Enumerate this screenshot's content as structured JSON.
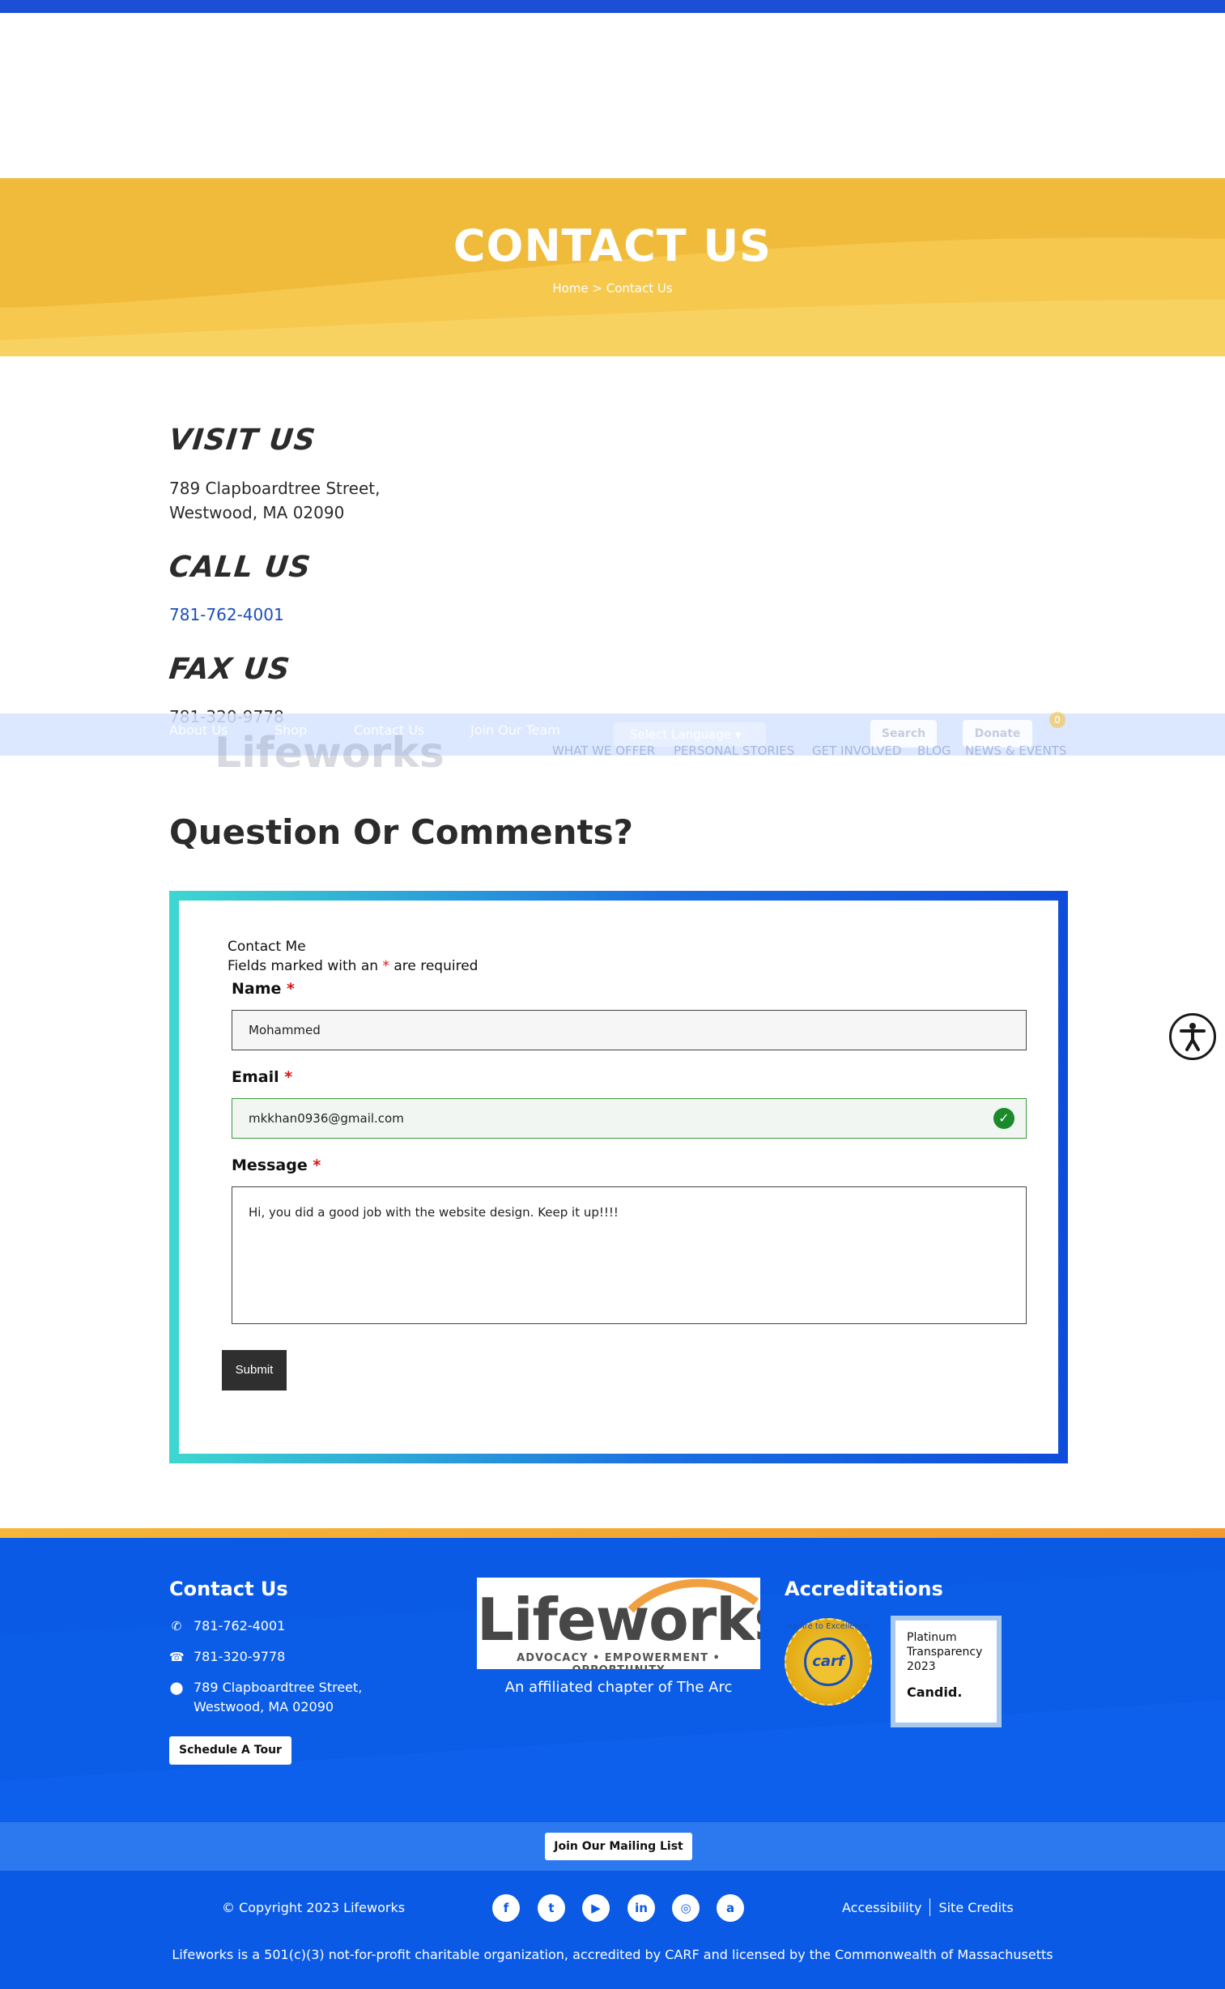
{
  "hero": {
    "title": "CONTACT US",
    "breadcrumb": "Home > Contact Us"
  },
  "visit": {
    "heading": "VISIT US",
    "address_line1": "789 Clapboardtree Street,",
    "address_line2": "Westwood, MA 02090"
  },
  "call": {
    "heading": "CALL US",
    "phone": "781-762-4001"
  },
  "fax": {
    "heading": "FAX US",
    "number": "781-320-9778"
  },
  "sticky_nav": {
    "logo": "Lifeworks",
    "top_links": [
      "About Us",
      "Shop",
      "Contact Us",
      "Join Our Team"
    ],
    "language_select": "Select Language",
    "search_label": "Search",
    "donate_label": "Donate",
    "cart_count": "0",
    "main_links": [
      "WHAT WE OFFER",
      "PERSONAL STORIES",
      "GET INVOLVED",
      "BLOG",
      "NEWS & EVENTS"
    ]
  },
  "questions": {
    "title": "Question Or Comments?"
  },
  "form": {
    "caption": "Contact Me",
    "required_note_before": "Fields marked with an ",
    "required_mark": "*",
    "required_note_after": " are required",
    "name_label": "Name",
    "name_value": "Mohammed",
    "email_label": "Email",
    "email_value": "mkkhan0936@gmail.com",
    "message_label": "Message",
    "message_value": "Hi, you did a good job with the website design. Keep it up!!!!",
    "submit_label": "Submit"
  },
  "footer": {
    "contact_heading": "Contact Us",
    "phone": "781-762-4001",
    "fax": "781-320-9778",
    "address_line1": "789 Clapboardtree Street,",
    "address_line2": "Westwood, MA 02090",
    "tour_button": "Schedule A Tour",
    "logo_word": "Lifeworks",
    "logo_tagline": "ADVOCACY • EMPOWERMENT • OPPORTUNITY",
    "affiliation": "An affiliated chapter of The Arc",
    "accreditations_heading": "Accreditations",
    "carf_ring": "Aspire to Excellence",
    "carf_word": "carf",
    "candid_lines": [
      "Platinum",
      "Transparency",
      "2023"
    ],
    "candid_brand": "Candid.",
    "mailing_button": "Join Our Mailing List",
    "copyright": "© Copyright 2023 Lifeworks",
    "links": [
      "Accessibility",
      "Site Credits"
    ],
    "legal": "Lifeworks is a 501(c)(3) not-for-profit charitable organization, accredited by CARF and licensed by the Commonwealth of Massachusetts"
  },
  "icons": {
    "phone": "phone-icon",
    "fax": "fax-icon",
    "location": "map-pin-icon",
    "check": "check-circle-icon",
    "accessibility": "accessibility-icon",
    "social": [
      "facebook-icon",
      "twitter-icon",
      "youtube-icon",
      "linkedin-icon",
      "instagram-icon",
      "amazon-icon"
    ]
  },
  "colors": {
    "brand_blue": "#0a5ae6",
    "hero_yellow": "#f2bd3b",
    "accent_orange": "#f29a2e",
    "valid_green": "#1b8a2b",
    "required_red": "#dd1111"
  }
}
